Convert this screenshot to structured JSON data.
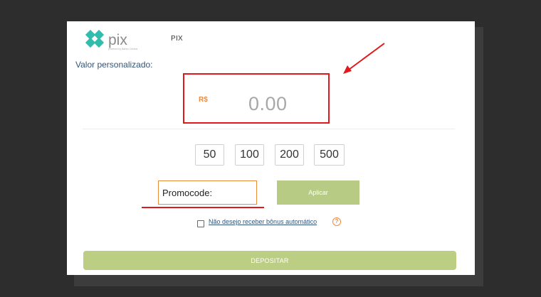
{
  "header": {
    "logo_text": "pix",
    "logo_sub": "powered by Banco Central",
    "tab_label": "PIX"
  },
  "deposit": {
    "custom_label": "Valor personalizado:",
    "currency_symbol": "R$",
    "amount_value": "0.00",
    "quick_amounts": [
      "50",
      "100",
      "200",
      "500"
    ]
  },
  "promo": {
    "placeholder": "Promocode:",
    "apply_label": "Aplicar"
  },
  "bonus": {
    "checkbox_label": "Não desejo receber bônus automático",
    "checked": false,
    "help_glyph": "?"
  },
  "actions": {
    "deposit_label": "DEPOSITAR"
  },
  "colors": {
    "highlight": "#e0191c",
    "accent_orange": "#f08a3c",
    "button_green": "#b8cb85",
    "label_blue": "#33557a",
    "pix_teal": "#32bcad"
  }
}
